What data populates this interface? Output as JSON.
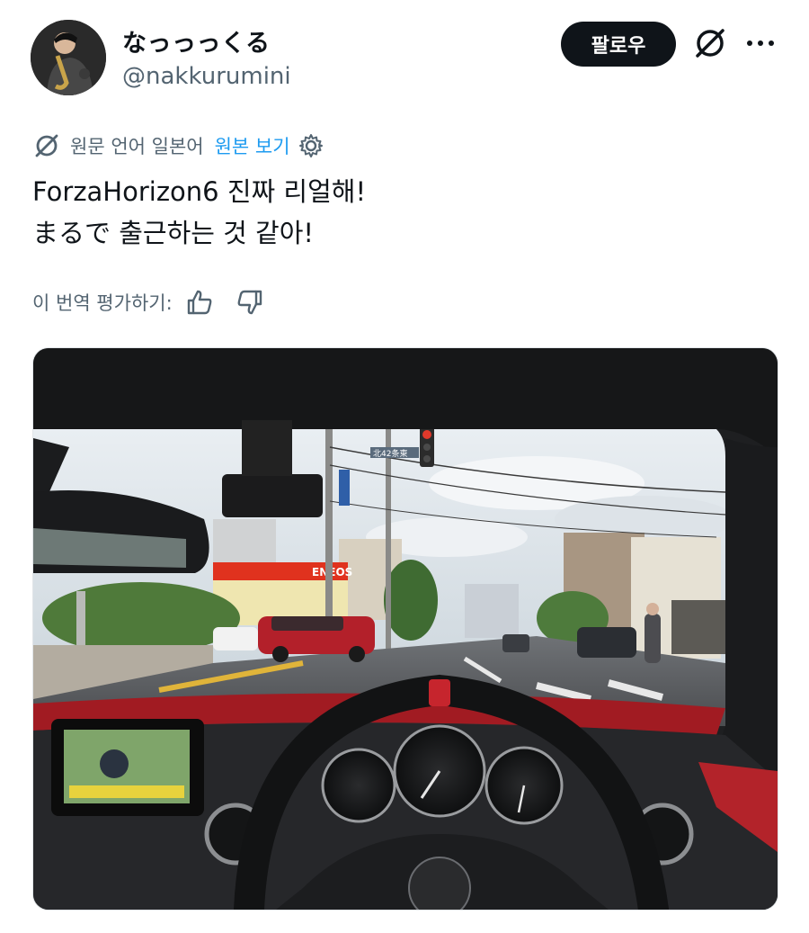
{
  "author": {
    "display_name": "なっっっくる",
    "handle": "@nakkurumini",
    "avatar_icon": "avatar-saxophone-player"
  },
  "actions": {
    "follow_label": "팔로우",
    "grok_icon": "grok-icon",
    "more_icon": "more-icon"
  },
  "translation": {
    "source_label": "원문 언어 일본어",
    "view_original_label": "원본 보기",
    "settings_icon": "gear-icon"
  },
  "tweet": {
    "lines": [
      "ForzaHorizon6 진짜 리얼해!",
      "まるで 출근하는 것 같아!"
    ]
  },
  "rate_translation": {
    "label": "이 번역 평가하기:",
    "up_icon": "thumbs-up-icon",
    "down_icon": "thumbs-down-icon"
  },
  "media": {
    "description_icon": "photo",
    "street_sign": "北42条東",
    "gas_station": "ENEOS"
  },
  "colors": {
    "accent": "#1d9bf0",
    "follow_bg": "#0f1419",
    "secondary_text": "#536471"
  }
}
